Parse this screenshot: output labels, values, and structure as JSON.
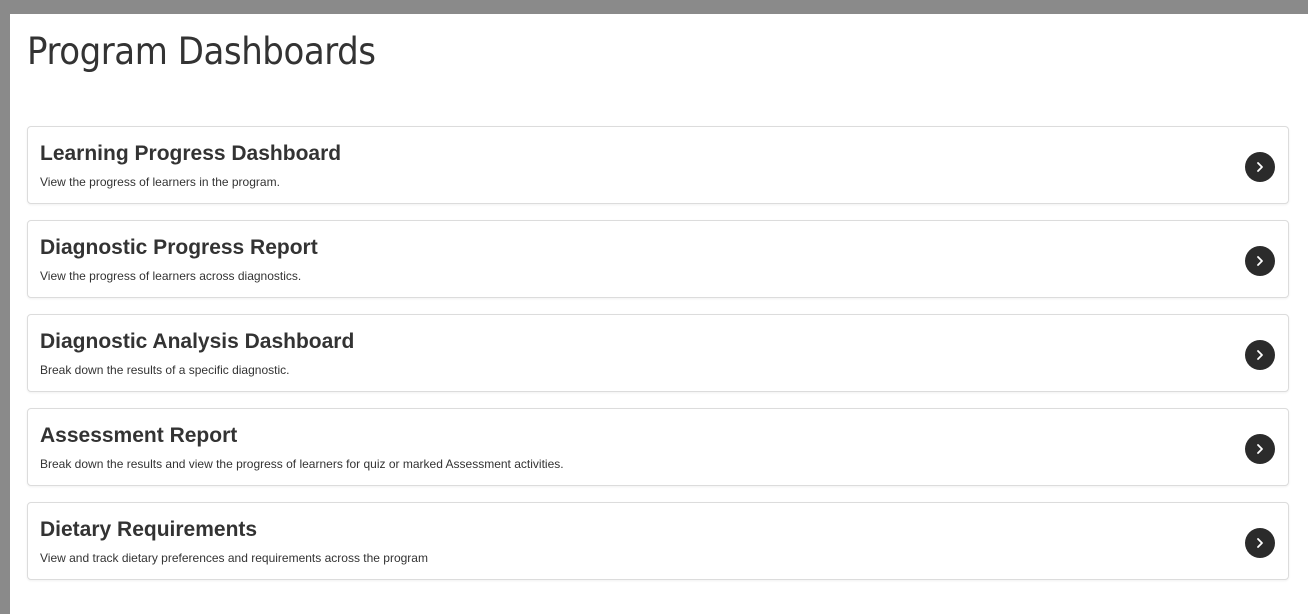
{
  "page": {
    "title": "Program Dashboards"
  },
  "dashboards": [
    {
      "title": "Learning Progress Dashboard",
      "description": "View the progress of learners in the program.",
      "icon": "chevron-right-icon"
    },
    {
      "title": "Diagnostic Progress Report",
      "description": "View the progress of learners across diagnostics.",
      "icon": "chevron-right-icon"
    },
    {
      "title": "Diagnostic Analysis Dashboard",
      "description": "Break down the results of a specific diagnostic.",
      "icon": "chevron-right-icon"
    },
    {
      "title": "Assessment Report",
      "description": "Break down the results and view the progress of learners for quiz or marked Assessment activities.",
      "icon": "chevron-right-icon"
    },
    {
      "title": "Dietary Requirements",
      "description": "View and track dietary preferences and requirements across the program",
      "icon": "chevron-right-icon"
    }
  ],
  "colors": {
    "text": "#333333",
    "icon_bg": "#2b2b2b",
    "card_border": "#dcdcdc",
    "frame": "#8a8a8a"
  }
}
